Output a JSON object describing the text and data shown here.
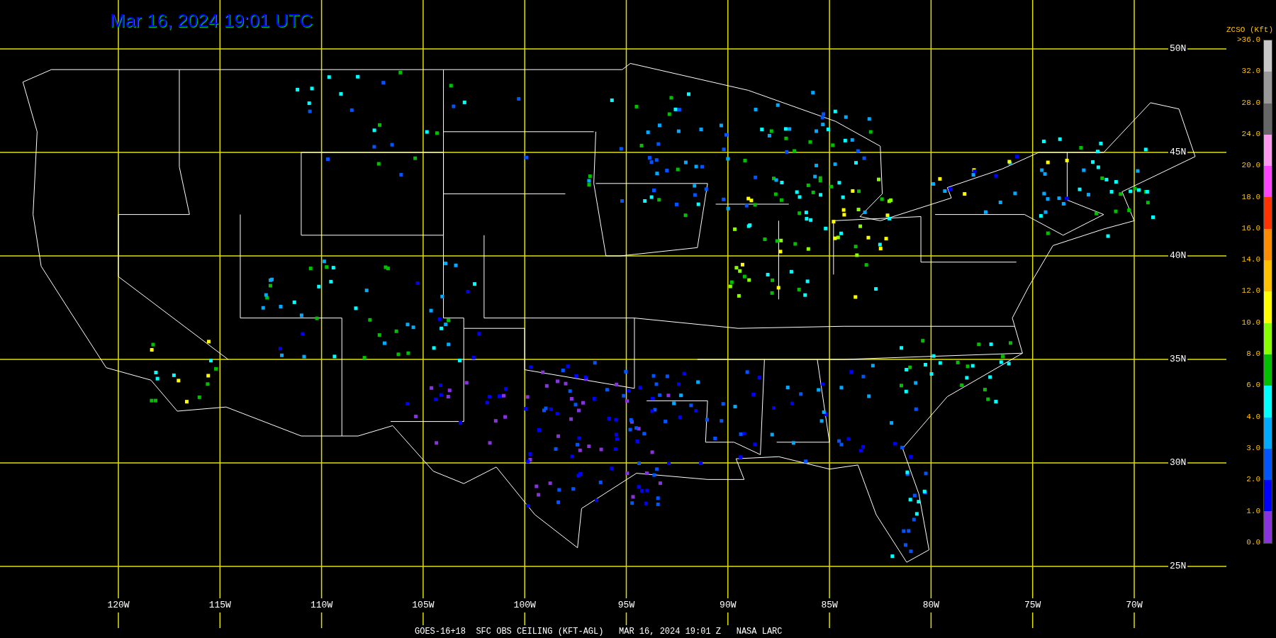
{
  "title": "Mar 16, 2024 19:01 UTC",
  "longitude_labels": [
    "120W",
    "115W",
    "110W",
    "105W",
    "100W",
    "95W",
    "90W",
    "85W",
    "80W",
    "75W",
    "70W"
  ],
  "latitude_labels": [
    "50N",
    "45N",
    "40N",
    "35N",
    "30N",
    "25N"
  ],
  "legend": {
    "title": "ZCSO (Kft)",
    "labels": [
      ">36.0",
      "32.0",
      "28.0",
      "24.0",
      "20.0",
      "18.0",
      "16.0",
      "14.0",
      "12.0",
      "10.0",
      "8.0",
      "6.0",
      "4.0",
      "3.0",
      "2.0",
      "1.0",
      "0.0"
    ],
    "segments": [
      {
        "color": "#c8c8c8"
      },
      {
        "color": "#999999"
      },
      {
        "color": "#666666"
      },
      {
        "color": "#ff99ee"
      },
      {
        "color": "#ff44ff"
      },
      {
        "color": "#ff3300"
      },
      {
        "color": "#ff8c00"
      },
      {
        "color": "#ffc000"
      },
      {
        "color": "#ffff00"
      },
      {
        "color": "#88ff00"
      },
      {
        "color": "#00c000"
      },
      {
        "color": "#00ffff"
      },
      {
        "color": "#00aaff"
      },
      {
        "color": "#0055ff"
      },
      {
        "color": "#0000ff"
      },
      {
        "color": "#8833dd"
      }
    ]
  },
  "caption": "GOES-16+18  SFC OBS CEILING (KFT-AGL)   MAR 16, 2024 19:01 Z   NASA LARC"
}
